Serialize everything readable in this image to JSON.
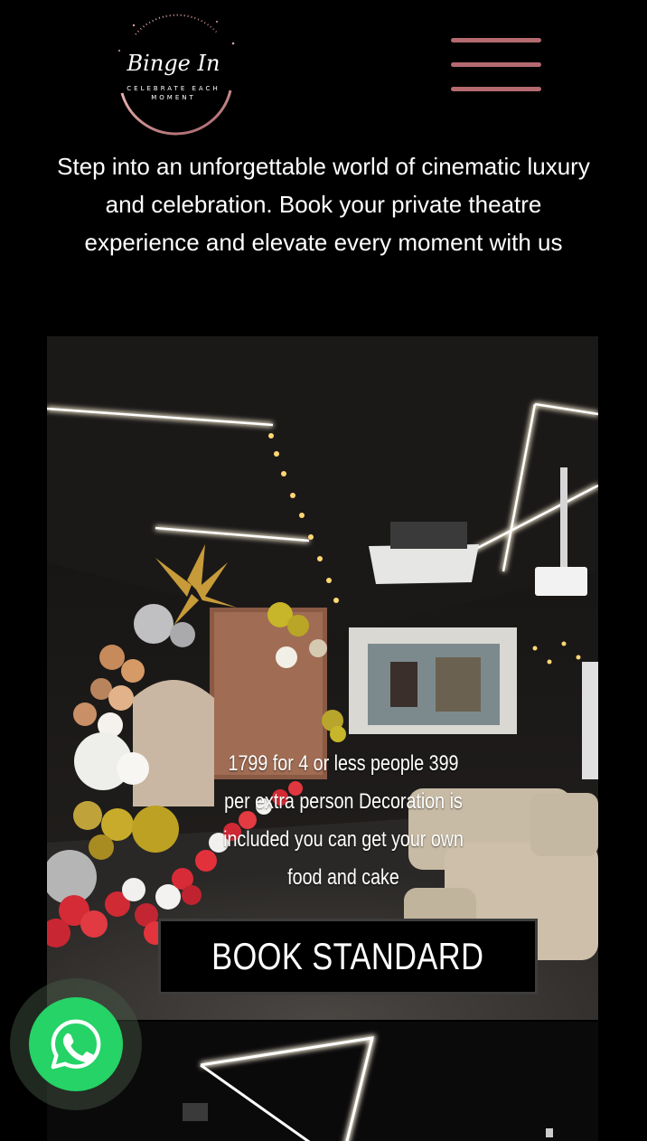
{
  "header": {
    "logo_script": "Binge In",
    "logo_tagline": "CELEBRATE EACH",
    "logo_tagline2": "MOMENT"
  },
  "intro": {
    "text": "Step into an unforgettable world of cinematic luxury and celebration. Book your private theatre experience and elevate every moment with us"
  },
  "package": {
    "description": "1799 for 4 or less people 399 per extra person Decoration is included you can get your own food and cake",
    "button_label": "BOOK STANDARD"
  },
  "icons": {
    "menu": "hamburger-menu-icon",
    "whatsapp": "whatsapp-icon"
  },
  "colors": {
    "background": "#000000",
    "menu_accent": "#b56a70",
    "whatsapp_green": "#25d366",
    "button_bg": "#000000"
  }
}
